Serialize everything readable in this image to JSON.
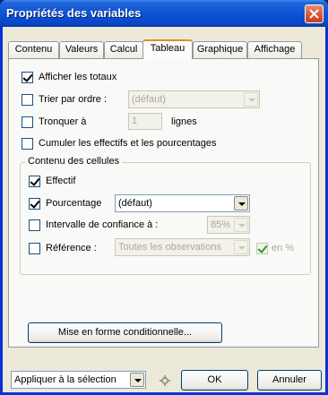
{
  "window": {
    "title": "Propriétés des variables",
    "close_icon": "close-icon"
  },
  "tabs": [
    {
      "label": "Contenu",
      "active": false
    },
    {
      "label": "Valeurs",
      "active": false
    },
    {
      "label": "Calcul",
      "active": false
    },
    {
      "label": "Tableau",
      "active": true
    },
    {
      "label": "Graphique",
      "active": false
    },
    {
      "label": "Affichage",
      "active": false
    }
  ],
  "options": {
    "afficher_totaux": {
      "label": "Afficher les totaux",
      "checked": true
    },
    "trier": {
      "label": "Trier par ordre :",
      "checked": false,
      "value": "(défaut)"
    },
    "tronquer": {
      "label": "Tronquer à",
      "checked": false,
      "value": "1",
      "suffix": "lignes"
    },
    "cumuler": {
      "label": "Cumuler les effectifs et les pourcentages",
      "checked": false
    }
  },
  "cell_content": {
    "group_title": "Contenu des cellules",
    "effectif": {
      "label": "Effectif",
      "checked": true
    },
    "pourcentage": {
      "label": "Pourcentage",
      "checked": true,
      "value": "(défaut)"
    },
    "intervalle": {
      "label": "Intervalle de confiance à :",
      "checked": false,
      "value": "85%"
    },
    "reference": {
      "label": "Référence :",
      "checked": false,
      "value": "Toutes les observations",
      "pct_label": "en %",
      "pct_checked": true
    }
  },
  "conditional_button": "Mise en forme conditionnelle...",
  "footer": {
    "apply_select": "Appliquer à la sélection",
    "ok": "OK",
    "cancel": "Annuler"
  },
  "colors": {
    "titlebar": "#0a53d6",
    "tab_active_accent": "#e68b2c",
    "check": "#21a121"
  }
}
